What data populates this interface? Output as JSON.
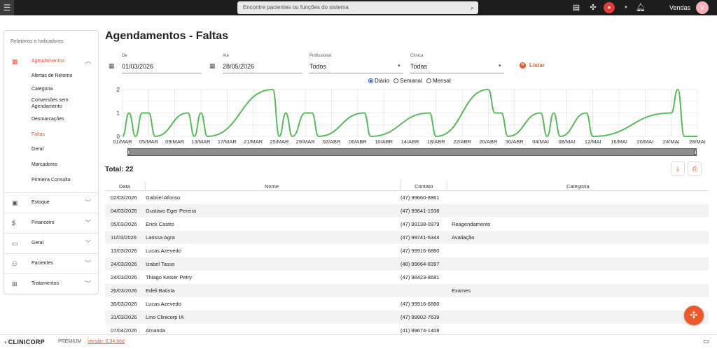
{
  "topbar": {
    "search_placeholder": "Encontre pacientes ou funções do sistema",
    "user_name": "Vendas",
    "avatar_letter": "V",
    "icons": [
      "menu-icon",
      "search-icon",
      "board-icon",
      "network-icon",
      "record-icon",
      "speedometer-icon",
      "bell-icon"
    ]
  },
  "sidebar": {
    "title": "Relatórios e Indicadores",
    "active_group": "Agendamentos",
    "active_item": "Faltas",
    "groups": [
      {
        "label": "Agendamentos",
        "icon": "calendar-icon",
        "expanded": true,
        "items": [
          "Alertas de Retorno",
          "Categoria",
          "Conversões sem Agendamento",
          "Desmarcações",
          "Faltas",
          "Geral",
          "Marcadores",
          "Primeira Consulta"
        ]
      },
      {
        "label": "Estoque",
        "icon": "box-icon"
      },
      {
        "label": "Financeiro",
        "icon": "dollar-icon"
      },
      {
        "label": "Geral",
        "icon": "card-icon"
      },
      {
        "label": "Pacientes",
        "icon": "people-icon"
      },
      {
        "label": "Tratamentos",
        "icon": "plus-box-icon"
      }
    ]
  },
  "page": {
    "title": "Agendamentos - Faltas",
    "filters": {
      "from_label": "De",
      "from_value": "01/03/2026",
      "to_label": "Até",
      "to_value": "28/05/2026",
      "prof_label": "Profissional",
      "prof_value": "Todos",
      "clinic_label": "Clínica",
      "clinic_value": "Todas",
      "list_button": "Listar"
    },
    "period_options": [
      {
        "label": "Diário",
        "selected": true
      },
      {
        "label": "Semanal",
        "selected": false
      },
      {
        "label": "Mensal",
        "selected": false
      }
    ],
    "total_label": "Total: 22"
  },
  "chart_data": {
    "type": "line",
    "x_tick_labels": [
      "01/MAR",
      "05/MAR",
      "09/MAR",
      "13/MAR",
      "17/MAR",
      "21/MAR",
      "25/MAR",
      "29/MAR",
      "02/ABR",
      "06/ABR",
      "10/ABR",
      "14/ABR",
      "18/ABR",
      "22/ABR",
      "26/ABR",
      "30/ABR",
      "04/MAI",
      "08/MAI",
      "12/MAI",
      "16/MAI",
      "20/MAI",
      "24/MAI",
      "28/MAI"
    ],
    "y_ticks": [
      0,
      0.5,
      1,
      1.5,
      2
    ],
    "ylim": [
      0,
      2
    ],
    "color": "#5cb85c",
    "points": [
      {
        "day": 0,
        "value": 0
      },
      {
        "day": 1,
        "value": 1
      },
      {
        "day": 2,
        "value": 0
      },
      {
        "day": 3,
        "value": 1
      },
      {
        "day": 4,
        "value": 1
      },
      {
        "day": 5,
        "value": 0
      },
      {
        "day": 10,
        "value": 1
      },
      {
        "day": 11,
        "value": 0
      },
      {
        "day": 12,
        "value": 1
      },
      {
        "day": 13,
        "value": 0
      },
      {
        "day": 23,
        "value": 2
      },
      {
        "day": 24,
        "value": 0
      },
      {
        "day": 25,
        "value": 1
      },
      {
        "day": 26,
        "value": 0
      },
      {
        "day": 28,
        "value": 1
      },
      {
        "day": 29,
        "value": 1
      },
      {
        "day": 30,
        "value": 0
      },
      {
        "day": 37,
        "value": 1
      },
      {
        "day": 38,
        "value": 0
      },
      {
        "day": 47,
        "value": 1
      },
      {
        "day": 48,
        "value": 0
      },
      {
        "day": 56,
        "value": 2
      },
      {
        "day": 57,
        "value": 1
      },
      {
        "day": 58,
        "value": 1
      },
      {
        "day": 59,
        "value": 0
      },
      {
        "day": 64,
        "value": 1
      },
      {
        "day": 65,
        "value": 0
      },
      {
        "day": 66,
        "value": 1
      },
      {
        "day": 67,
        "value": 0
      },
      {
        "day": 71,
        "value": 1
      },
      {
        "day": 72,
        "value": 0
      },
      {
        "day": 84,
        "value": 1
      },
      {
        "day": 85,
        "value": 2
      },
      {
        "day": 86,
        "value": 0
      },
      {
        "day": 88,
        "value": 0
      }
    ]
  },
  "table": {
    "columns": [
      "Data",
      "Nome",
      "Contato",
      "Categoria"
    ],
    "rows": [
      [
        "02/03/2026",
        "Gabriel Afonso",
        "(47) 99660-8861",
        ""
      ],
      [
        "04/03/2026",
        "Gustavo Eger Pereira",
        "(47) 99641-1938",
        ""
      ],
      [
        "05/03/2026",
        "Erick Castro",
        "(47) 99138-0979",
        "Reagendamento"
      ],
      [
        "11/03/2026",
        "Larissa Agra",
        "(47) 99741-5344",
        "Avaliação"
      ],
      [
        "13/03/2026",
        "Lucas Azevedo",
        "(47) 99916-6880",
        ""
      ],
      [
        "24/03/2026",
        "Izabel Tasso",
        "(48) 99664-8397",
        ""
      ],
      [
        "24/03/2026",
        "Thiago Keiser Petry",
        "(47) 98423-8681",
        ""
      ],
      [
        "26/03/2026",
        "Edeli Batista",
        "",
        "Exames"
      ],
      [
        "30/03/2026",
        "Lucas Azevedo",
        "(47) 99916-6880",
        ""
      ],
      [
        "31/03/2026",
        "Lino Clinicorp IA",
        "(47) 99902-7639",
        ""
      ],
      [
        "07/04/2026",
        "Amanda",
        "(41) 99674-1408",
        ""
      ]
    ]
  },
  "footer": {
    "logo_text": "CLINICORP",
    "plan": "PREMIUM",
    "version": "Versão: 0.34.66d"
  }
}
